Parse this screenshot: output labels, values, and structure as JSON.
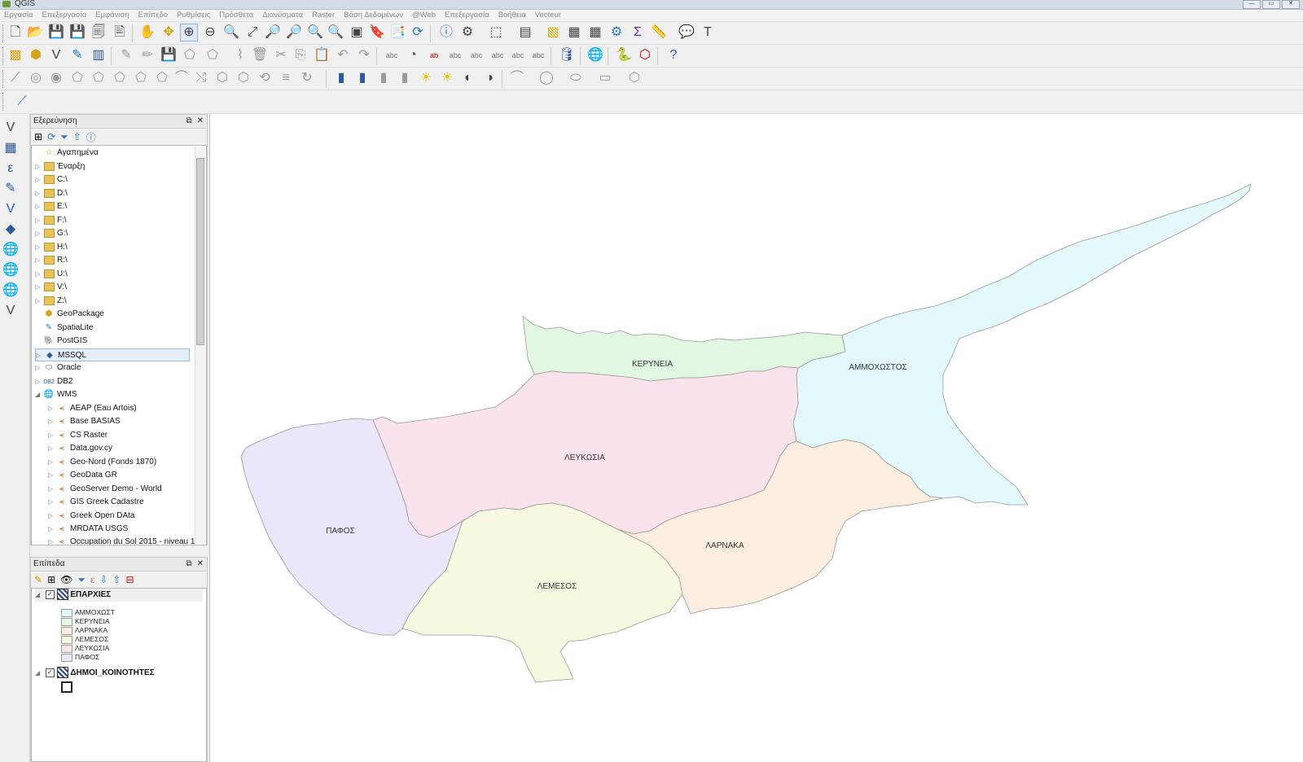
{
  "window": {
    "title": "QGIS"
  },
  "menubar": [
    "Εργασία",
    "Επεξεργασία",
    "Εμφάνιση",
    "Επίπεδο",
    "Ρυθμίσεις",
    "Πρόσθετα",
    "Διανύσματα",
    "Raster",
    "Βάση Δεδομένων",
    "@Web",
    "Επεξεργασία",
    "Βοήθεια",
    "Vecteur"
  ],
  "browser_panel": {
    "title": "Εξερεύνηση",
    "items": [
      {
        "label": "Αγαπημένα",
        "icon": "star-icon"
      },
      {
        "label": "Έναρξη",
        "icon": "folder-icon"
      },
      {
        "label": "C:\\",
        "icon": "folder-icon"
      },
      {
        "label": "D:\\",
        "icon": "folder-icon"
      },
      {
        "label": "E:\\",
        "icon": "folder-icon"
      },
      {
        "label": "F:\\",
        "icon": "folder-icon"
      },
      {
        "label": "G:\\",
        "icon": "folder-icon"
      },
      {
        "label": "H:\\",
        "icon": "folder-icon"
      },
      {
        "label": "R:\\",
        "icon": "folder-icon"
      },
      {
        "label": "U:\\",
        "icon": "folder-icon"
      },
      {
        "label": "V:\\",
        "icon": "folder-icon"
      },
      {
        "label": "Z:\\",
        "icon": "folder-icon"
      },
      {
        "label": "GeoPackage",
        "icon": "geopackage-icon"
      },
      {
        "label": "SpatiaLite",
        "icon": "spatialite-icon"
      },
      {
        "label": "PostGIS",
        "icon": "postgis-icon"
      },
      {
        "label": "MSSQL",
        "icon": "mssql-icon"
      },
      {
        "label": "Oracle",
        "icon": "oracle-icon"
      },
      {
        "label": "DB2",
        "icon": "db2-icon"
      },
      {
        "label": "WMS",
        "icon": "globe-icon"
      },
      {
        "label": "AEAP (Eau Artois)",
        "icon": "wms-connection-icon"
      },
      {
        "label": "Base BASIAS",
        "icon": "wms-connection-icon"
      },
      {
        "label": "CS Raster",
        "icon": "wms-connection-icon"
      },
      {
        "label": "Data.gov.cy",
        "icon": "wms-connection-icon"
      },
      {
        "label": "Geo-Nord (Fonds 1870)",
        "icon": "wms-connection-icon"
      },
      {
        "label": "GeoData GR",
        "icon": "wms-connection-icon"
      },
      {
        "label": "GeoServer Demo - World",
        "icon": "wms-connection-icon"
      },
      {
        "label": "GIS Greek Cadastre",
        "icon": "wms-connection-icon"
      },
      {
        "label": "Greek Open DAta",
        "icon": "wms-connection-icon"
      },
      {
        "label": "MRDATA USGS",
        "icon": "wms-connection-icon"
      },
      {
        "label": "Occupation du Sol 2015 - niveau 1",
        "icon": "wms-connection-icon"
      }
    ]
  },
  "layers_panel": {
    "title": "Επίπεδα",
    "layers": [
      {
        "name": "ΕΠΑΡΧΙΕΣ",
        "checked": true,
        "classes": [
          {
            "label": "ΑΜΜΟΧΩΣΤ",
            "color": "#e4f9fb"
          },
          {
            "label": "ΚΕΡΥΝΕΙΑ",
            "color": "#e1f7e1"
          },
          {
            "label": "ΛΑΡΝΑΚΑ",
            "color": "#fbeee0"
          },
          {
            "label": "ΛΕΜΕΣΟΣ",
            "color": "#f6f8df"
          },
          {
            "label": "ΛΕΥΚΩΣΙΑ",
            "color": "#fbe3ee"
          },
          {
            "label": "ΠΑΦΟΣ",
            "color": "#ebe6fa"
          }
        ]
      },
      {
        "name": "ΔΗΜΟΙ_ΚΟΙΝΟΤΗΤΕΣ",
        "checked": true
      }
    ]
  },
  "map": {
    "districts": [
      {
        "label": "ΚΕΡΥΝΕΙΑ",
        "color": "#e1f7e1"
      },
      {
        "label": "ΑΜΜΟΧΩΣΤΟΣ",
        "color": "#e4f9fb"
      },
      {
        "label": "ΛΕΥΚΩΣΙΑ",
        "color": "#fbe3ee"
      },
      {
        "label": "ΠΑΦΟΣ",
        "color": "#ebe6fa"
      },
      {
        "label": "ΛΑΡΝΑΚΑ",
        "color": "#fbeee0"
      },
      {
        "label": "ΛΕΜΕΣΟΣ",
        "color": "#f6f8df"
      }
    ]
  }
}
